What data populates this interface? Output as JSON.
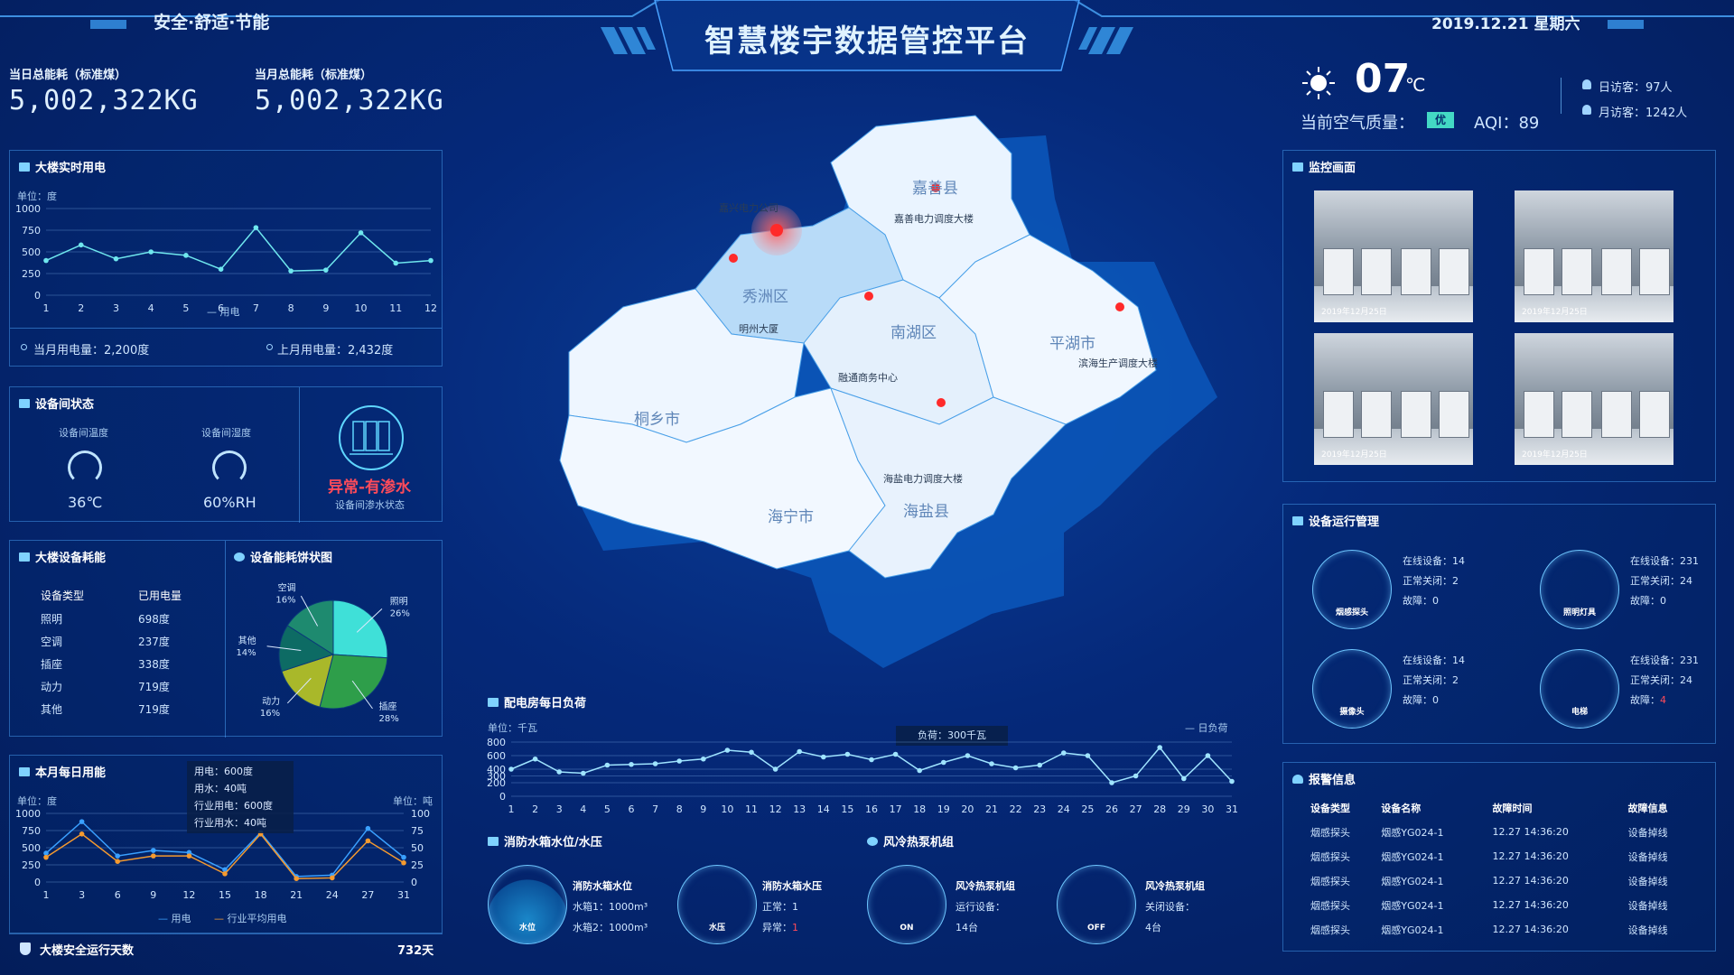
{
  "header": {
    "title": "智慧楼宇数据管控平台",
    "slogan": "安全·舒适·节能",
    "date": "2019.12.21 星期六"
  },
  "energy": {
    "day_label": "当日总能耗（标准煤）",
    "day_value": "5,002,322KG",
    "month_label": "当月总能耗（标准煤）",
    "month_value": "5,002,322KG"
  },
  "weather": {
    "temp": "07",
    "unit": "℃",
    "air_label": "当前空气质量：",
    "air_badge": "优",
    "aqi": "AQI：89",
    "day_visitors": "日访客：97人",
    "month_visitors": "月访客：1242人"
  },
  "power_panel": {
    "title": "大楼实时用电",
    "unit": "单位：度",
    "legend": "用电",
    "this_month": "当月用电量：2,200度",
    "last_month": "上月用电量：2,432度"
  },
  "room_panel": {
    "title": "设备间状态",
    "temp_label": "设备间温度",
    "hum_label": "设备间湿度",
    "temp_value": "36℃",
    "hum_value": "60%RH",
    "alarm": "异常-有渗水",
    "alarm_sub": "设备间渗水状态"
  },
  "consume_panel": {
    "title": "大楼设备耗能",
    "col1": "设备类型",
    "col2": "已用电量",
    "rows": [
      {
        "type": "照明",
        "value": "698度"
      },
      {
        "type": "空调",
        "value": "237度"
      },
      {
        "type": "插座",
        "value": "338度"
      },
      {
        "type": "动力",
        "value": "719度"
      },
      {
        "type": "其他",
        "value": "719度"
      }
    ]
  },
  "pie_panel": {
    "title": "设备能耗饼状图",
    "labels": [
      {
        "name": "照明",
        "pct": "26%"
      },
      {
        "name": "插座",
        "pct": "28%"
      },
      {
        "name": "动力",
        "pct": "16%"
      },
      {
        "name": "其他",
        "pct": "14%"
      },
      {
        "name": "空调",
        "pct": "16%"
      }
    ]
  },
  "daily_panel": {
    "title": "本月每日用能",
    "unit_left": "单位：度",
    "unit_right": "单位：吨",
    "legend1": "用电",
    "legend2": "行业平均用电",
    "tooltip": [
      "用电：600度",
      "用水：40吨",
      "行业用电：600度",
      "行业用水：40吨"
    ]
  },
  "safety": {
    "label": "大楼安全运行天数",
    "value": "732天"
  },
  "map": {
    "regions": [
      "嘉善县",
      "秀洲区",
      "南湖区",
      "平湖市",
      "桐乡市",
      "海宁市",
      "海盐县"
    ],
    "points": [
      "嘉兴电力公司",
      "嘉善电力调度大楼",
      "明州大厦",
      "融通商务中心",
      "滨海生产调度大楼",
      "海盐电力调度大楼"
    ]
  },
  "load_panel": {
    "title": "配电房每日负荷",
    "unit": "单位：千瓦",
    "legend": "日负荷",
    "tooltip": "负荷：300千瓦"
  },
  "water_panel": {
    "title": "消防水箱水位/水压",
    "level_title": "消防水箱水位",
    "level_1": "水箱1：1000m³",
    "level_2": "水箱2：1000m³",
    "level_icon": "水位",
    "press_title": "消防水箱水压",
    "press_normal_label": "正常：",
    "press_normal_value": "1",
    "press_abnormal_label": "异常：",
    "press_abnormal_value": "1",
    "press_icon": "水压"
  },
  "pump_panel": {
    "title": "风冷热泵机组",
    "unit1_title": "风冷热泵机组",
    "unit1_l1": "运行设备：",
    "unit1_l2": "14台",
    "unit1_icon": "ON",
    "unit2_title": "风冷热泵机组",
    "unit2_l1": "关闭设备：",
    "unit2_l2": "4台",
    "unit2_icon": "OFF"
  },
  "monitor_panel": {
    "title": "监控画面",
    "date": "2019年12月25日"
  },
  "device_panel": {
    "title": "设备运行管理",
    "items": [
      {
        "name": "烟感探头",
        "online": "在线设备：14",
        "off": "正常关闭：2",
        "fault_label": "故障：",
        "fault": "0"
      },
      {
        "name": "照明灯具",
        "online": "在线设备：231",
        "off": "正常关闭：24",
        "fault_label": "故障：",
        "fault": "0"
      },
      {
        "name": "摄像头",
        "online": "在线设备：14",
        "off": "正常关闭：2",
        "fault_label": "故障：",
        "fault": "0"
      },
      {
        "name": "电梯",
        "online": "在线设备：231",
        "off": "正常关闭：24",
        "fault_label": "故障：",
        "fault": "4"
      }
    ]
  },
  "alarm_panel": {
    "title": "报警信息",
    "headers": [
      "设备类型",
      "设备名称",
      "故障时间",
      "故障信息"
    ],
    "rows": [
      [
        "烟感探头",
        "烟感YG024-1",
        "12.27 14:36:20",
        "设备掉线"
      ],
      [
        "烟感探头",
        "烟感YG024-1",
        "12.27 14:36:20",
        "设备掉线"
      ],
      [
        "烟感探头",
        "烟感YG024-1",
        "12.27 14:36:20",
        "设备掉线"
      ],
      [
        "烟感探头",
        "烟感YG024-1",
        "12.27 14:36:20",
        "设备掉线"
      ],
      [
        "烟感探头",
        "烟感YG024-1",
        "12.27 14:36:20",
        "设备掉线"
      ]
    ]
  },
  "chart_data": [
    {
      "type": "line",
      "title": "大楼实时用电",
      "ylabel": "单位：度",
      "categories": [
        "1",
        "2",
        "3",
        "4",
        "5",
        "6",
        "7",
        "8",
        "9",
        "10",
        "11",
        "12"
      ],
      "yticks": [
        "0",
        "250",
        "500",
        "750",
        "1000"
      ],
      "ylim": [
        0,
        1000
      ],
      "series": [
        {
          "name": "用电",
          "values": [
            400,
            580,
            420,
            500,
            460,
            300,
            780,
            280,
            290,
            720,
            370,
            400
          ]
        }
      ]
    },
    {
      "type": "pie",
      "title": "设备能耗饼状图",
      "categories": [
        "照明",
        "插座",
        "动力",
        "其他",
        "空调"
      ],
      "values": [
        26,
        28,
        16,
        14,
        16
      ],
      "colors": [
        "#3fe0d8",
        "#2e9e4a",
        "#a9b82a",
        "#0d6b64",
        "#1e8a6f"
      ]
    },
    {
      "type": "line",
      "title": "本月每日用能",
      "categories": [
        "1",
        "3",
        "6",
        "9",
        "12",
        "15",
        "18",
        "21",
        "24",
        "27",
        "31"
      ],
      "yticks_left": [
        "0",
        "250",
        "500",
        "750",
        "1000"
      ],
      "yticks_right": [
        "0",
        "25",
        "50",
        "75",
        "100"
      ],
      "ylim": [
        0,
        1000
      ],
      "series": [
        {
          "name": "用电",
          "values": [
            420,
            880,
            380,
            460,
            430,
            180,
            720,
            80,
            100,
            780,
            360
          ]
        },
        {
          "name": "行业平均用电",
          "values": [
            360,
            700,
            300,
            380,
            380,
            120,
            700,
            50,
            60,
            600,
            280
          ]
        }
      ]
    },
    {
      "type": "line",
      "title": "配电房每日负荷",
      "ylabel": "单位：千瓦",
      "categories": [
        "1",
        "2",
        "3",
        "4",
        "5",
        "6",
        "7",
        "8",
        "9",
        "10",
        "11",
        "12",
        "13",
        "14",
        "15",
        "16",
        "17",
        "18",
        "19",
        "20",
        "21",
        "22",
        "23",
        "24",
        "25",
        "26",
        "27",
        "28",
        "29",
        "30",
        "31"
      ],
      "yticks": [
        "0",
        "200",
        "300",
        "400",
        "600",
        "800"
      ],
      "ylim": [
        0,
        800
      ],
      "series": [
        {
          "name": "日负荷",
          "values": [
            400,
            550,
            360,
            340,
            460,
            470,
            480,
            520,
            550,
            680,
            650,
            400,
            660,
            580,
            620,
            540,
            620,
            380,
            500,
            600,
            480,
            420,
            460,
            640,
            600,
            200,
            300,
            720,
            260,
            600,
            220
          ]
        }
      ]
    }
  ]
}
